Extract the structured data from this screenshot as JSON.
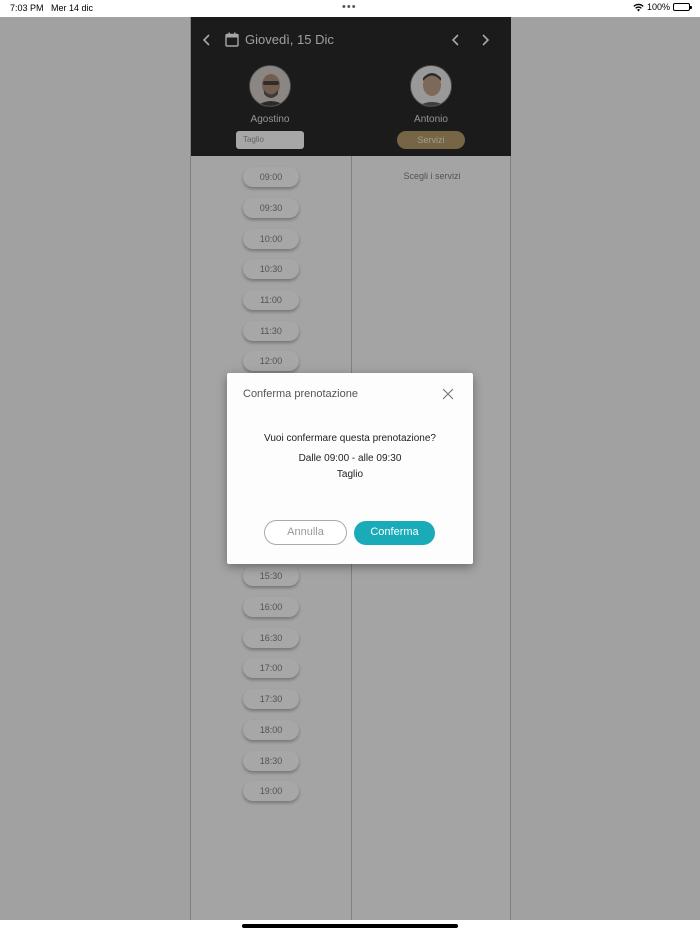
{
  "status_bar": {
    "time": "7:03 PM",
    "date": "Mer 14 dic",
    "dots": "•••",
    "battery": "100%"
  },
  "header": {
    "date_label": "Giovedì, 15 Dic"
  },
  "staff": [
    {
      "name": "Agostino",
      "service_value": "Taglio"
    },
    {
      "name": "Antonio",
      "service_button": "Servizi"
    }
  ],
  "right_column": {
    "hint": "Scegli i servizi"
  },
  "slots": [
    "09:00",
    "09:30",
    "10:00",
    "10:30",
    "11:00",
    "11:30",
    "12:00",
    "15:30",
    "16:00",
    "16:30",
    "17:00",
    "17:30",
    "18:00",
    "18:30",
    "19:00"
  ],
  "dialog": {
    "title": "Conferma prenotazione",
    "question": "Vuoi confermare questa prenotazione?",
    "time_range": "Dalle 09:00 - alle 09:30",
    "service": "Taglio",
    "cancel_label": "Annulla",
    "confirm_label": "Conferma"
  },
  "colors": {
    "header_bg": "#000000",
    "accent": "#1aabb8",
    "service_button": "#a8894f"
  },
  "icons": [
    "back-arrow-icon",
    "calendar-icon",
    "chevron-left-icon",
    "chevron-right-icon",
    "close-icon",
    "wifi-icon",
    "battery-icon"
  ]
}
